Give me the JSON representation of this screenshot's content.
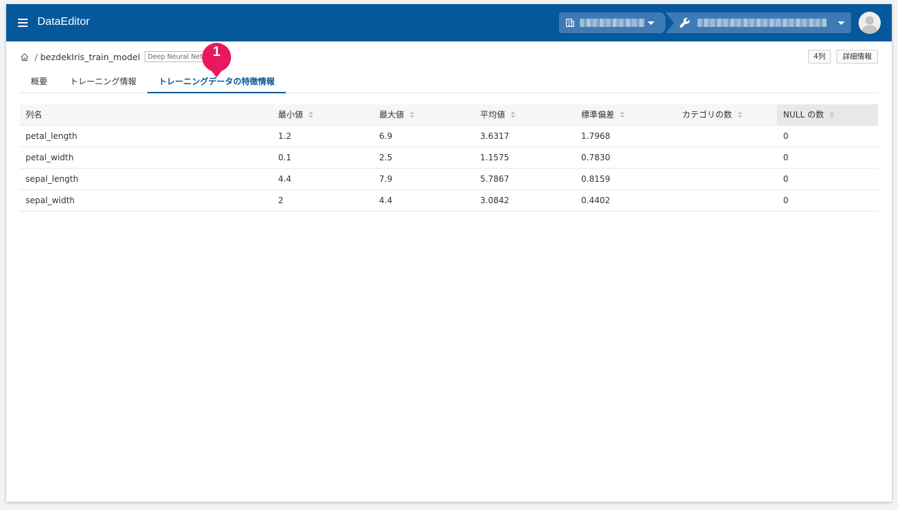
{
  "header": {
    "app_title": "DataEditor",
    "colors": {
      "primary": "#06589c",
      "select_bg": "#3e7ab5"
    },
    "org_selector": {
      "icon": "building-icon"
    },
    "project_selector": {
      "icon": "wrench-icon"
    }
  },
  "breadcrumb": {
    "model_name": "bezdekIris_train_model",
    "model_type_badge": "Deep Neural Network"
  },
  "actions": {
    "columns_count": "4列",
    "details": "詳細情報"
  },
  "tabs": [
    {
      "label": "概要"
    },
    {
      "label": "トレーニング情報"
    },
    {
      "label": "トレーニングデータの特徴情報",
      "active": true
    }
  ],
  "callout": {
    "number": "1",
    "color": "#e8185f"
  },
  "table": {
    "headers": [
      "列名",
      "最小値",
      "最大値",
      "平均値",
      "標準偏差",
      "カテゴリの数",
      "NULL の数"
    ],
    "rows": [
      [
        "petal_length",
        "1.2",
        "6.9",
        "3.6317",
        "1.7968",
        "",
        "0"
      ],
      [
        "petal_width",
        "0.1",
        "2.5",
        "1.1575",
        "0.7830",
        "",
        "0"
      ],
      [
        "sepal_length",
        "4.4",
        "7.9",
        "5.7867",
        "0.8159",
        "",
        "0"
      ],
      [
        "sepal_width",
        "2",
        "4.4",
        "3.0842",
        "0.4402",
        "",
        "0"
      ]
    ]
  }
}
